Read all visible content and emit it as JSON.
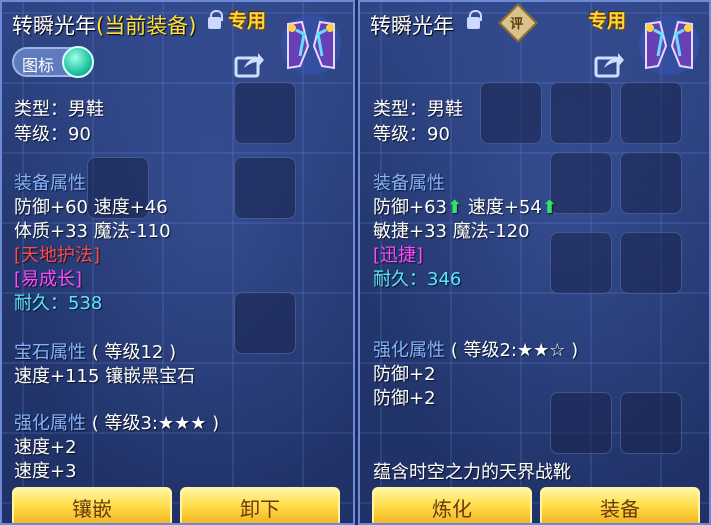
{
  "left_panel": {
    "item_name": "转瞬光年",
    "equipped_tag": "(当前装备)",
    "exclusive_label": "专用",
    "icon_toggle_label": "图标",
    "type_line": "类型：男鞋",
    "level_line": "等级：90",
    "equip_attr_heading": "装备属性",
    "attr_line_1": "防御+60 速度+46",
    "attr_line_2": "体质+33 魔法-110",
    "effect_1": "[天地护法]",
    "effect_2": "[易成长]",
    "durability_label": "耐久：",
    "durability_value": "538",
    "gem_heading": "宝石属性",
    "gem_level": "( 等级12 )",
    "gem_line": "速度+115 镶嵌黑宝石",
    "enhance_heading": "强化属性",
    "enhance_level": "( 等级3:★★★ )",
    "enhance_line_1": "速度+2",
    "enhance_line_2": "速度+3",
    "buttons": {
      "inlay": "镶嵌",
      "unequip": "卸下"
    }
  },
  "right_panel": {
    "item_name": "转瞬光年",
    "review_label": "评",
    "exclusive_label": "专用",
    "type_line": "类型：男鞋",
    "level_line": "等级：90",
    "equip_attr_heading": "装备属性",
    "attr_line_1a": "防御+63",
    "attr_line_1b": "速度+54",
    "attr_line_2": "敏捷+33 魔法-120",
    "effect_1": "[迅捷]",
    "durability_label": "耐久：",
    "durability_value": "346",
    "enhance_heading": "强化属性",
    "enhance_level": "( 等级2:★★☆ )",
    "enhance_line_1": "防御+2",
    "enhance_line_2": "防御+2",
    "description": "蕴含时空之力的天界战靴",
    "buttons": {
      "refine": "炼化",
      "equip": "装备"
    }
  },
  "colors": {
    "panel_bg": "#24386f",
    "equipped_tag": "#ffe13b",
    "section_heading": "#83b3ff",
    "effect_red": "#ff4a4a",
    "trait_magenta": "#ff4aff",
    "durability_cyan": "#59e7ff",
    "increase_arrow": "#35e06a",
    "button_gold": "#ffde4a"
  },
  "icons": {
    "lock": "lock-icon",
    "share": "share-icon",
    "item": "boots-item-icon",
    "up": "up-arrow-icon",
    "review": "review-icon"
  }
}
